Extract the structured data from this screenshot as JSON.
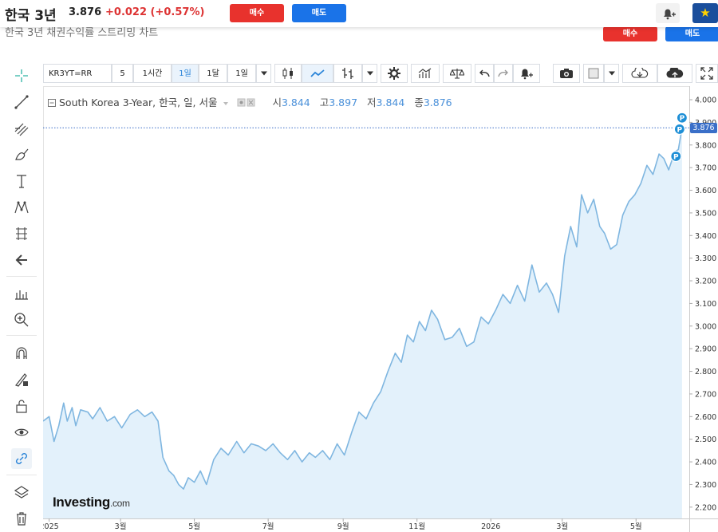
{
  "header": {
    "title": "한국 3년",
    "price": "3.876",
    "change": "+0.022",
    "change_pct": "(+0.57%)",
    "buy_label": "매수",
    "sell_label": "매도",
    "faded_title": "한국 3년 채권수익률 스트리밍 차트"
  },
  "toolbar": {
    "symbol": "KR3YT=RR",
    "intervals": [
      "5",
      "1시간",
      "1일",
      "1달",
      "1일"
    ],
    "selected_interval": "1일"
  },
  "legend": {
    "name": "South Korea 3-Year, 한국, 일, 서울",
    "open_label": "시",
    "open": "3.844",
    "high_label": "고",
    "high": "3.897",
    "low_label": "저",
    "low": "3.844",
    "close_label": "종",
    "close": "3.876"
  },
  "logo": {
    "text": "Investing",
    "suffix": ".com"
  },
  "colors": {
    "line": "#7fb6e0",
    "fill": "#e3f1fb",
    "accent": "#1a73e8",
    "down": "#e8322d",
    "marker": "#1e8fd6"
  },
  "chart_data": {
    "type": "area",
    "title": "South Korea 3-Year",
    "ylim": [
      2.15,
      4.06
    ],
    "y_ticks": [
      2.2,
      2.3,
      2.4,
      2.5,
      2.6,
      2.7,
      2.8,
      2.9,
      3.0,
      3.1,
      3.2,
      3.3,
      3.4,
      3.5,
      3.6,
      3.7,
      3.8,
      3.9,
      4.0
    ],
    "y_tick_labels": [
      "2.200",
      "2.300",
      "2.400",
      "2.500",
      "2.600",
      "2.700",
      "2.800",
      "2.900",
      "3.000",
      "3.100",
      "3.200",
      "3.300",
      "3.400",
      "3.500",
      "3.600",
      "3.700",
      "3.800",
      "3.900",
      "4.000"
    ],
    "x_range": [
      "2024-12-27",
      "2026-06-14"
    ],
    "x_ticks": [
      "2025-01-01",
      "2025-03-01",
      "2025-05-01",
      "2025-07-01",
      "2025-09-01",
      "2025-11-01",
      "2026-01-01",
      "2026-03-01",
      "2026-05-01"
    ],
    "x_tick_labels": [
      "2025",
      "3월",
      "5월",
      "7월",
      "9월",
      "11월",
      "2026",
      "3월",
      "5월"
    ],
    "last_price_label": "3.876",
    "markers": [
      {
        "date": "2026-06-03",
        "value": 3.75,
        "label": "P"
      },
      {
        "date": "2026-06-06",
        "value": 3.87,
        "label": "P"
      },
      {
        "date": "2026-06-08",
        "value": 3.92,
        "label": "P"
      }
    ],
    "series": [
      {
        "x": [
          "2024-12-27",
          "2025-01-01",
          "2025-01-05",
          "2025-01-09",
          "2025-01-13",
          "2025-01-16",
          "2025-01-20",
          "2025-01-23",
          "2025-01-27",
          "2025-02-02",
          "2025-02-06",
          "2025-02-12",
          "2025-02-18",
          "2025-02-24",
          "2025-03-02",
          "2025-03-09",
          "2025-03-15",
          "2025-03-21",
          "2025-03-27",
          "2025-04-01",
          "2025-04-05",
          "2025-04-10",
          "2025-04-14",
          "2025-04-18",
          "2025-04-22",
          "2025-04-26",
          "2025-05-01",
          "2025-05-06",
          "2025-05-11",
          "2025-05-17",
          "2025-05-23",
          "2025-05-29",
          "2025-06-05",
          "2025-06-11",
          "2025-06-17",
          "2025-06-23",
          "2025-06-29",
          "2025-07-05",
          "2025-07-11",
          "2025-07-17",
          "2025-07-23",
          "2025-07-29",
          "2025-08-04",
          "2025-08-09",
          "2025-08-15",
          "2025-08-21",
          "2025-08-27",
          "2025-09-02",
          "2025-09-08",
          "2025-09-14",
          "2025-09-20",
          "2025-09-26",
          "2025-10-02",
          "2025-10-08",
          "2025-10-14",
          "2025-10-19",
          "2025-10-24",
          "2025-10-29",
          "2025-11-03",
          "2025-11-08",
          "2025-11-13",
          "2025-11-18",
          "2025-11-24",
          "2025-11-30",
          "2025-12-06",
          "2025-12-12",
          "2025-12-18",
          "2025-12-24",
          "2025-12-30",
          "2026-01-05",
          "2026-01-11",
          "2026-01-17",
          "2026-01-23",
          "2026-01-29",
          "2026-02-04",
          "2026-02-10",
          "2026-02-16",
          "2026-02-21",
          "2026-02-26",
          "2026-03-03",
          "2026-03-08",
          "2026-03-13",
          "2026-03-17",
          "2026-03-22",
          "2026-03-27",
          "2026-04-01",
          "2026-04-05",
          "2026-04-10",
          "2026-04-15",
          "2026-04-20",
          "2026-04-25",
          "2026-04-30",
          "2026-05-05",
          "2026-05-10",
          "2026-05-15",
          "2026-05-20",
          "2026-05-24",
          "2026-05-28",
          "2026-06-02",
          "2026-06-05",
          "2026-06-08"
        ],
        "y": [
          2.58,
          2.6,
          2.49,
          2.56,
          2.66,
          2.58,
          2.64,
          2.56,
          2.63,
          2.62,
          2.59,
          2.64,
          2.58,
          2.6,
          2.55,
          2.61,
          2.63,
          2.6,
          2.62,
          2.58,
          2.42,
          2.36,
          2.34,
          2.3,
          2.28,
          2.33,
          2.31,
          2.36,
          2.3,
          2.41,
          2.46,
          2.43,
          2.49,
          2.44,
          2.48,
          2.47,
          2.45,
          2.48,
          2.44,
          2.41,
          2.45,
          2.4,
          2.44,
          2.42,
          2.45,
          2.41,
          2.48,
          2.43,
          2.53,
          2.62,
          2.59,
          2.66,
          2.71,
          2.8,
          2.88,
          2.84,
          2.96,
          2.93,
          3.02,
          2.98,
          3.07,
          3.03,
          2.94,
          2.95,
          2.99,
          2.91,
          2.93,
          3.04,
          3.01,
          3.07,
          3.14,
          3.1,
          3.18,
          3.11,
          3.27,
          3.15,
          3.19,
          3.14,
          3.06,
          3.31,
          3.44,
          3.35,
          3.58,
          3.5,
          3.56,
          3.44,
          3.41,
          3.34,
          3.36,
          3.49,
          3.55,
          3.58,
          3.63,
          3.71,
          3.67,
          3.76,
          3.74,
          3.69,
          3.77,
          3.78,
          3.876
        ]
      }
    ]
  }
}
